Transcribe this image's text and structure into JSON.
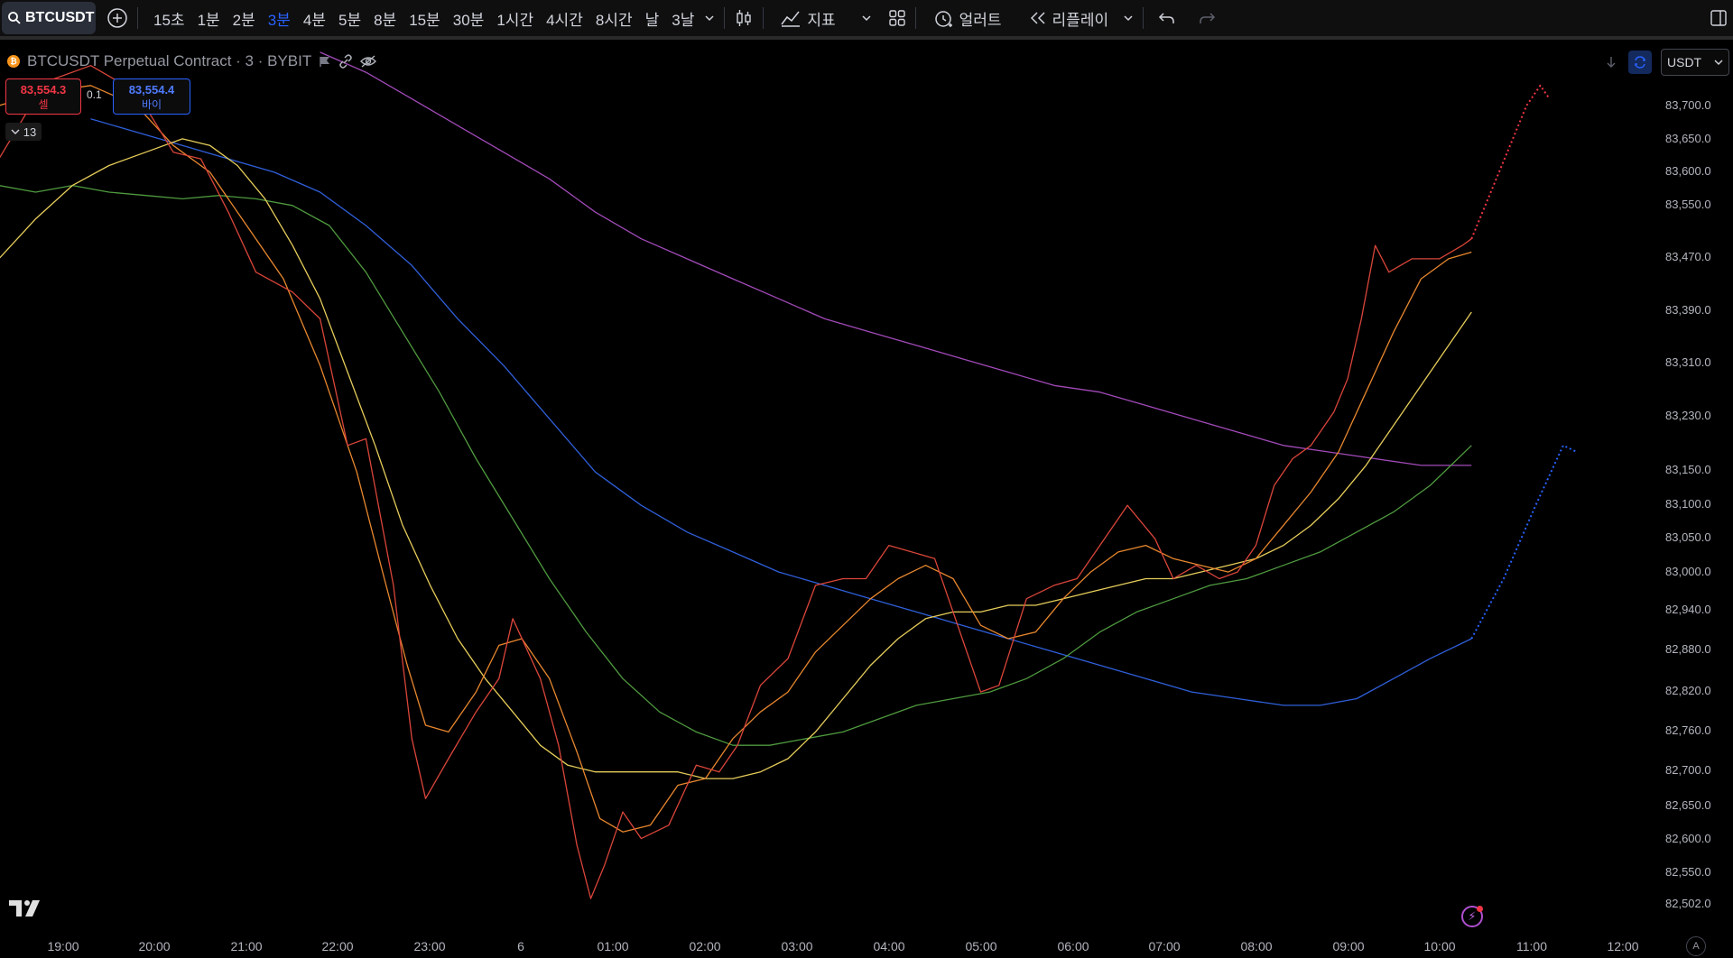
{
  "toolbar": {
    "symbol": "BTCUSDT",
    "intervals": [
      "15초",
      "1분",
      "2분",
      "3분",
      "4분",
      "5분",
      "8분",
      "15분",
      "30분",
      "1시간",
      "4시간",
      "8시간",
      "날",
      "3날"
    ],
    "active_interval": "3분",
    "indicators_label": "지표",
    "alert_label": "얼러트",
    "replay_label": "리플레이"
  },
  "legend": {
    "title": "BTCUSDT Perpetual Contract · 3 · BYBIT"
  },
  "trade": {
    "sell_price": "83,554.3",
    "sell_label": "셀",
    "spread": "0.1",
    "buy_price": "83,554.4",
    "buy_label": "바이",
    "indicator_count": "13"
  },
  "currency": "USDT",
  "colors": {
    "background": "#000000",
    "accent": "#2962ff",
    "sell": "#f23645",
    "buy": "#2962ff",
    "ma_red": "#d9453a",
    "ma_orange": "#e8872e",
    "ma_yellow": "#e6cd5a",
    "ma_green": "#4f9a3f",
    "ma_blue": "#2f5fd9",
    "ma_purple": "#a14ab8"
  },
  "chart_data": {
    "type": "line",
    "y_axis_labels": [
      "83,700.0",
      "83,650.0",
      "83,600.0",
      "83,550.0",
      "83,470.0",
      "83,390.0",
      "83,310.0",
      "83,230.0",
      "83,150.0",
      "83,100.0",
      "83,050.0",
      "83,000.0",
      "82,940.0",
      "82,880.0",
      "82,820.0",
      "82,760.0",
      "82,700.0",
      "82,650.0",
      "82,600.0",
      "82,550.0",
      "82,502.0"
    ],
    "x_axis_labels": [
      "19:00",
      "20:00",
      "21:00",
      "22:00",
      "23:00",
      "6",
      "01:00",
      "02:00",
      "03:00",
      "04:00",
      "05:00",
      "06:00",
      "07:00",
      "08:00",
      "09:00",
      "10:00",
      "11:00",
      "12:00"
    ],
    "x_hours": [
      19,
      20,
      21,
      22,
      23,
      24,
      25,
      26,
      27,
      28,
      29,
      30,
      31,
      32,
      33,
      34,
      35,
      36
    ],
    "y_range": [
      82500,
      83730
    ],
    "series": [
      {
        "color": "#d9453a",
        "points": [
          [
            18.3,
            83620
          ],
          [
            18.8,
            83735
          ],
          [
            19.3,
            83760
          ],
          [
            19.8,
            83720
          ],
          [
            20.2,
            83630
          ],
          [
            20.5,
            83620
          ],
          [
            20.8,
            83540
          ],
          [
            21.1,
            83450
          ],
          [
            21.5,
            83420
          ],
          [
            21.8,
            83380
          ],
          [
            22.1,
            83190
          ],
          [
            22.3,
            83200
          ],
          [
            22.6,
            82980
          ],
          [
            22.8,
            82750
          ],
          [
            22.95,
            82660
          ],
          [
            23.2,
            82720
          ],
          [
            23.5,
            82790
          ],
          [
            23.75,
            82840
          ],
          [
            23.9,
            82930
          ],
          [
            24.2,
            82840
          ],
          [
            24.4,
            82740
          ],
          [
            24.6,
            82590
          ],
          [
            24.75,
            82510
          ],
          [
            24.9,
            82560
          ],
          [
            25.1,
            82640
          ],
          [
            25.3,
            82600
          ],
          [
            25.6,
            82620
          ],
          [
            25.9,
            82710
          ],
          [
            26.15,
            82700
          ],
          [
            26.35,
            82740
          ],
          [
            26.6,
            82830
          ],
          [
            26.9,
            82870
          ],
          [
            27.2,
            82980
          ],
          [
            27.5,
            82990
          ],
          [
            27.75,
            82990
          ],
          [
            28.0,
            83040
          ],
          [
            28.25,
            83030
          ],
          [
            28.5,
            83020
          ],
          [
            28.8,
            82900
          ],
          [
            29.0,
            82820
          ],
          [
            29.2,
            82830
          ],
          [
            29.5,
            82960
          ],
          [
            29.8,
            82980
          ],
          [
            30.05,
            82990
          ],
          [
            30.3,
            83040
          ],
          [
            30.6,
            83100
          ],
          [
            30.9,
            83050
          ],
          [
            31.1,
            82990
          ],
          [
            31.35,
            83010
          ],
          [
            31.6,
            82990
          ],
          [
            31.8,
            83000
          ],
          [
            32.0,
            83040
          ],
          [
            32.2,
            83130
          ],
          [
            32.4,
            83170
          ],
          [
            32.6,
            83190
          ],
          [
            32.85,
            83240
          ],
          [
            33.0,
            83290
          ],
          [
            33.15,
            83380
          ],
          [
            33.3,
            83490
          ],
          [
            33.45,
            83450
          ],
          [
            33.7,
            83470
          ],
          [
            34.0,
            83470
          ],
          [
            34.25,
            83490
          ],
          [
            34.35,
            83500
          ]
        ]
      },
      {
        "color": "#e8872e",
        "points": [
          [
            18.3,
            83700
          ],
          [
            18.8,
            83720
          ],
          [
            19.3,
            83730
          ],
          [
            19.8,
            83700
          ],
          [
            20.2,
            83640
          ],
          [
            20.6,
            83600
          ],
          [
            21.0,
            83520
          ],
          [
            21.4,
            83440
          ],
          [
            21.8,
            83310
          ],
          [
            22.2,
            83150
          ],
          [
            22.5,
            82990
          ],
          [
            22.75,
            82860
          ],
          [
            22.95,
            82770
          ],
          [
            23.2,
            82760
          ],
          [
            23.5,
            82820
          ],
          [
            23.75,
            82890
          ],
          [
            24.0,
            82900
          ],
          [
            24.3,
            82840
          ],
          [
            24.6,
            82730
          ],
          [
            24.85,
            82630
          ],
          [
            25.1,
            82610
          ],
          [
            25.4,
            82620
          ],
          [
            25.7,
            82680
          ],
          [
            26.0,
            82690
          ],
          [
            26.3,
            82750
          ],
          [
            26.6,
            82790
          ],
          [
            26.9,
            82820
          ],
          [
            27.2,
            82880
          ],
          [
            27.5,
            82920
          ],
          [
            27.8,
            82960
          ],
          [
            28.1,
            82990
          ],
          [
            28.4,
            83010
          ],
          [
            28.7,
            82990
          ],
          [
            29.0,
            82920
          ],
          [
            29.3,
            82900
          ],
          [
            29.6,
            82910
          ],
          [
            29.9,
            82960
          ],
          [
            30.2,
            83000
          ],
          [
            30.5,
            83030
          ],
          [
            30.8,
            83040
          ],
          [
            31.1,
            83020
          ],
          [
            31.4,
            83010
          ],
          [
            31.7,
            83000
          ],
          [
            32.0,
            83020
          ],
          [
            32.3,
            83070
          ],
          [
            32.6,
            83120
          ],
          [
            32.9,
            83180
          ],
          [
            33.2,
            83270
          ],
          [
            33.5,
            83360
          ],
          [
            33.8,
            83440
          ],
          [
            34.1,
            83470
          ],
          [
            34.35,
            83480
          ]
        ]
      },
      {
        "color": "#e6cd5a",
        "points": [
          [
            18.3,
            83470
          ],
          [
            18.7,
            83530
          ],
          [
            19.1,
            83580
          ],
          [
            19.5,
            83610
          ],
          [
            19.9,
            83630
          ],
          [
            20.3,
            83650
          ],
          [
            20.6,
            83640
          ],
          [
            20.9,
            83610
          ],
          [
            21.2,
            83560
          ],
          [
            21.5,
            83490
          ],
          [
            21.8,
            83410
          ],
          [
            22.1,
            83300
          ],
          [
            22.4,
            83190
          ],
          [
            22.7,
            83070
          ],
          [
            23.0,
            82980
          ],
          [
            23.3,
            82900
          ],
          [
            23.6,
            82840
          ],
          [
            23.9,
            82790
          ],
          [
            24.2,
            82740
          ],
          [
            24.5,
            82710
          ],
          [
            24.8,
            82700
          ],
          [
            25.1,
            82700
          ],
          [
            25.4,
            82700
          ],
          [
            25.7,
            82700
          ],
          [
            26.0,
            82690
          ],
          [
            26.3,
            82690
          ],
          [
            26.6,
            82700
          ],
          [
            26.9,
            82720
          ],
          [
            27.2,
            82760
          ],
          [
            27.5,
            82810
          ],
          [
            27.8,
            82860
          ],
          [
            28.1,
            82900
          ],
          [
            28.4,
            82930
          ],
          [
            28.7,
            82940
          ],
          [
            29.0,
            82940
          ],
          [
            29.3,
            82950
          ],
          [
            29.6,
            82950
          ],
          [
            29.9,
            82960
          ],
          [
            30.2,
            82970
          ],
          [
            30.5,
            82980
          ],
          [
            30.8,
            82990
          ],
          [
            31.1,
            82990
          ],
          [
            31.4,
            83000
          ],
          [
            31.7,
            83010
          ],
          [
            32.0,
            83020
          ],
          [
            32.3,
            83040
          ],
          [
            32.6,
            83070
          ],
          [
            32.9,
            83110
          ],
          [
            33.2,
            83160
          ],
          [
            33.5,
            83220
          ],
          [
            33.8,
            83280
          ],
          [
            34.1,
            83340
          ],
          [
            34.35,
            83390
          ]
        ]
      },
      {
        "color": "#4f9a3f",
        "points": [
          [
            18.3,
            83580
          ],
          [
            18.7,
            83570
          ],
          [
            19.1,
            83580
          ],
          [
            19.5,
            83570
          ],
          [
            19.9,
            83565
          ],
          [
            20.3,
            83560
          ],
          [
            20.7,
            83565
          ],
          [
            21.1,
            83560
          ],
          [
            21.5,
            83550
          ],
          [
            21.9,
            83520
          ],
          [
            22.3,
            83450
          ],
          [
            22.7,
            83360
          ],
          [
            23.1,
            83270
          ],
          [
            23.5,
            83170
          ],
          [
            23.9,
            83080
          ],
          [
            24.3,
            82990
          ],
          [
            24.7,
            82910
          ],
          [
            25.1,
            82840
          ],
          [
            25.5,
            82790
          ],
          [
            25.9,
            82760
          ],
          [
            26.3,
            82740
          ],
          [
            26.7,
            82740
          ],
          [
            27.1,
            82750
          ],
          [
            27.5,
            82760
          ],
          [
            27.9,
            82780
          ],
          [
            28.3,
            82800
          ],
          [
            28.7,
            82810
          ],
          [
            29.1,
            82820
          ],
          [
            29.5,
            82840
          ],
          [
            29.9,
            82870
          ],
          [
            30.3,
            82910
          ],
          [
            30.7,
            82940
          ],
          [
            31.1,
            82960
          ],
          [
            31.5,
            82980
          ],
          [
            31.9,
            82990
          ],
          [
            32.3,
            83010
          ],
          [
            32.7,
            83030
          ],
          [
            33.1,
            83060
          ],
          [
            33.5,
            83090
          ],
          [
            33.9,
            83130
          ],
          [
            34.35,
            83190
          ]
        ]
      },
      {
        "color": "#2f5fd9",
        "points": [
          [
            19.3,
            83680
          ],
          [
            19.8,
            83660
          ],
          [
            20.3,
            83640
          ],
          [
            20.8,
            83620
          ],
          [
            21.3,
            83600
          ],
          [
            21.8,
            83570
          ],
          [
            22.3,
            83520
          ],
          [
            22.8,
            83460
          ],
          [
            23.3,
            83380
          ],
          [
            23.8,
            83310
          ],
          [
            24.3,
            83230
          ],
          [
            24.8,
            83150
          ],
          [
            25.3,
            83100
          ],
          [
            25.8,
            83060
          ],
          [
            26.3,
            83030
          ],
          [
            26.8,
            83000
          ],
          [
            27.3,
            82980
          ],
          [
            27.8,
            82960
          ],
          [
            28.3,
            82940
          ],
          [
            28.8,
            82920
          ],
          [
            29.3,
            82900
          ],
          [
            29.8,
            82880
          ],
          [
            30.3,
            82860
          ],
          [
            30.8,
            82840
          ],
          [
            31.3,
            82820
          ],
          [
            31.8,
            82810
          ],
          [
            32.3,
            82800
          ],
          [
            32.7,
            82800
          ],
          [
            33.1,
            82810
          ],
          [
            33.5,
            82840
          ],
          [
            33.9,
            82870
          ],
          [
            34.35,
            82900
          ]
        ]
      },
      {
        "color": "#a14ab8",
        "points": [
          [
            21.8,
            83780
          ],
          [
            22.3,
            83750
          ],
          [
            22.8,
            83710
          ],
          [
            23.3,
            83670
          ],
          [
            23.8,
            83630
          ],
          [
            24.3,
            83590
          ],
          [
            24.8,
            83540
          ],
          [
            25.3,
            83500
          ],
          [
            25.8,
            83470
          ],
          [
            26.3,
            83440
          ],
          [
            26.8,
            83410
          ],
          [
            27.3,
            83380
          ],
          [
            27.8,
            83360
          ],
          [
            28.3,
            83340
          ],
          [
            28.8,
            83320
          ],
          [
            29.3,
            83300
          ],
          [
            29.8,
            83280
          ],
          [
            30.3,
            83270
          ],
          [
            30.8,
            83250
          ],
          [
            31.3,
            83230
          ],
          [
            31.8,
            83210
          ],
          [
            32.3,
            83190
          ],
          [
            32.8,
            83180
          ],
          [
            33.3,
            83170
          ],
          [
            33.8,
            83160
          ],
          [
            34.35,
            83160
          ]
        ]
      }
    ],
    "projections": [
      {
        "color": "#f23645",
        "points": [
          [
            34.35,
            83500
          ],
          [
            34.65,
            83600
          ],
          [
            34.95,
            83700
          ],
          [
            35.1,
            83730
          ],
          [
            35.2,
            83710
          ]
        ]
      },
      {
        "color": "#2962ff",
        "points": [
          [
            34.35,
            82900
          ],
          [
            34.7,
            82990
          ],
          [
            35.05,
            83100
          ],
          [
            35.35,
            83190
          ],
          [
            35.5,
            83180
          ]
        ]
      }
    ]
  }
}
